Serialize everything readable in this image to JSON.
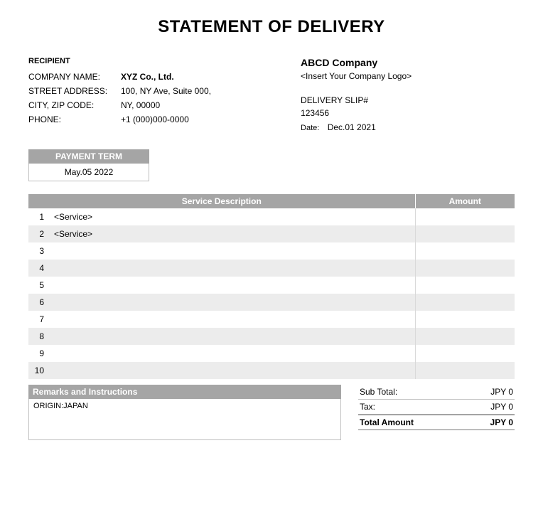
{
  "title": "STATEMENT OF DELIVERY",
  "recipient": {
    "section_label": "RECIPIENT",
    "company_label": "COMPANY NAME:",
    "company_value": "XYZ Co., Ltd.",
    "street_label": "STREET ADDRESS:",
    "street_value": "100, NY Ave, Suite 000,",
    "city_label": "CITY, ZIP CODE:",
    "city_value": "NY, 00000",
    "phone_label": "PHONE:",
    "phone_value": "+1 (000)000-0000"
  },
  "sender": {
    "company": "ABCD Company",
    "logo_placeholder": "<Insert Your Company Logo>",
    "slip_label": "DELIVERY SLIP#",
    "slip_value": "123456",
    "date_label": "Date:",
    "date_value": "Dec.01 2021"
  },
  "payment_term": {
    "header": "PAYMENT TERM",
    "value": "May.05 2022"
  },
  "service_table": {
    "desc_header": "Service Description",
    "amount_header": "Amount",
    "rows": [
      {
        "n": "1",
        "desc": "<Service>",
        "amt": ""
      },
      {
        "n": "2",
        "desc": "<Service>",
        "amt": ""
      },
      {
        "n": "3",
        "desc": "",
        "amt": ""
      },
      {
        "n": "4",
        "desc": "",
        "amt": ""
      },
      {
        "n": "5",
        "desc": "",
        "amt": ""
      },
      {
        "n": "6",
        "desc": "",
        "amt": ""
      },
      {
        "n": "7",
        "desc": "",
        "amt": ""
      },
      {
        "n": "8",
        "desc": "",
        "amt": ""
      },
      {
        "n": "9",
        "desc": "",
        "amt": ""
      },
      {
        "n": "10",
        "desc": "",
        "amt": ""
      }
    ]
  },
  "remarks": {
    "header": "Remarks and Instructions",
    "body": "ORIGIN:JAPAN"
  },
  "totals": {
    "subtotal_label": "Sub Total:",
    "subtotal_value": "JPY 0",
    "tax_label": "Tax:",
    "tax_value": "JPY 0",
    "total_label": "Total Amount",
    "total_value": "JPY 0"
  }
}
